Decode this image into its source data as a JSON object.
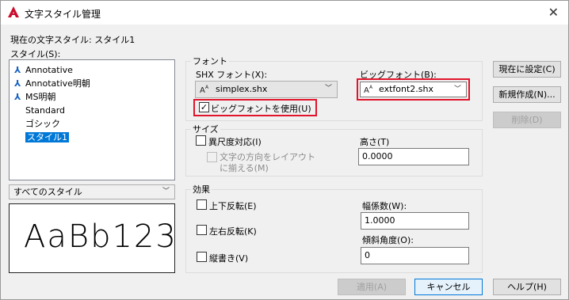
{
  "window": {
    "title": "文字スタイル管理",
    "close_glyph": "✕"
  },
  "current_style": {
    "label": "現在の文字スタイル: スタイル1"
  },
  "styles": {
    "label": "スタイル(S):",
    "items": [
      {
        "label": "Annotative",
        "annotative": true,
        "selected": false
      },
      {
        "label": "Annotative明朝",
        "annotative": true,
        "selected": false
      },
      {
        "label": "MS明朝",
        "annotative": true,
        "selected": false
      },
      {
        "label": "Standard",
        "annotative": false,
        "selected": false
      },
      {
        "label": "ゴシック",
        "annotative": false,
        "selected": false
      },
      {
        "label": "スタイル1",
        "annotative": false,
        "selected": true
      }
    ],
    "filter_value": "すべてのスタイル"
  },
  "preview": {
    "text": "AaBb123"
  },
  "font": {
    "group_label": "フォント",
    "shx_label": "SHX フォント(X):",
    "shx_value": "simplex.shx",
    "big_label": "ビッグフォント(B):",
    "big_value": "extfont2.shx",
    "use_big_label": "ビッグフォントを使用(U)",
    "use_big_checked": true
  },
  "size": {
    "group_label": "サイズ",
    "annotative_label": "異尺度対応(I)",
    "match_layout_label_1": "文字の方向をレイアウト",
    "match_layout_label_2": "に揃える(M)",
    "height_label": "高さ(T)",
    "height_value": "0.0000"
  },
  "effects": {
    "group_label": "効果",
    "upside_down_label": "上下反転(E)",
    "backwards_label": "左右反転(K)",
    "vertical_label": "縦書き(V)",
    "width_label": "幅係数(W):",
    "width_value": "1.0000",
    "oblique_label": "傾斜角度(O):",
    "oblique_value": "0"
  },
  "buttons": {
    "set_current": "現在に設定(C)",
    "new": "新規作成(N)...",
    "delete": "削除(D)",
    "apply": "適用(A)",
    "cancel": "キャンセル",
    "help": "ヘルプ(H)"
  },
  "icons": {
    "annotative": "triangle-a-icon",
    "font": "font-a-icon",
    "check": "checkmark-icon",
    "chevron": "chevron-down-icon"
  },
  "colors": {
    "selection": "#0078d7",
    "highlight_box": "#e0142c",
    "annotative_icon": "#1560c0"
  }
}
